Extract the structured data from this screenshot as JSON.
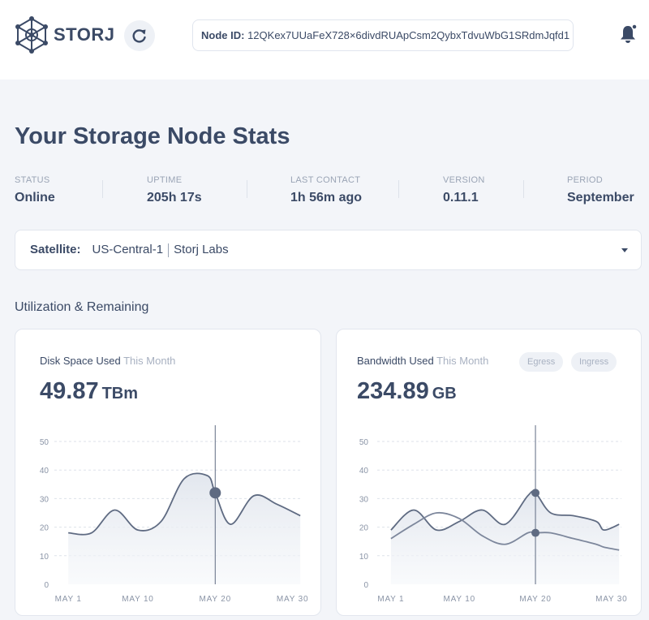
{
  "header": {
    "logo_text": "STORJ",
    "node_id_label": "Node ID:",
    "node_id_value": "12QKex7UUaFeX728×6divdRUApCsm2QybxTdvuWbG1SRdmJqfd1"
  },
  "page_title": "Your Storage Node Stats",
  "stats": [
    {
      "label": "STATUS",
      "value": "Online"
    },
    {
      "label": "UPTIME",
      "value": "205h 17s"
    },
    {
      "label": "LAST CONTACT",
      "value": "1h 56m ago"
    },
    {
      "label": "VERSION",
      "value": "0.11.1"
    },
    {
      "label": "PERIOD",
      "value": "September"
    }
  ],
  "satellite": {
    "label": "Satellite:",
    "name": "US-Central-1",
    "owner": "Storj Labs"
  },
  "section_title": "Utilization & Remaining",
  "disk_card": {
    "title": "Disk Space Used",
    "title_muted": "This Month",
    "value": "49.87",
    "unit": "TBm"
  },
  "bandwidth_card": {
    "title": "Bandwidth Used",
    "title_muted": "This Month",
    "value": "234.89",
    "unit": "GB",
    "pills": [
      "Egress",
      "Ingress"
    ]
  },
  "colors": {
    "text": "#3b4a66",
    "muted": "#9aa4b5",
    "line": "#7d879c",
    "line_dark": "#5f6b82"
  },
  "chart_data": [
    {
      "type": "area",
      "x": [
        1,
        4,
        7,
        10,
        13,
        16,
        19,
        20,
        22,
        25,
        28,
        31
      ],
      "series": [
        {
          "values": [
            18,
            18,
            26,
            19,
            22,
            37,
            38,
            32,
            21,
            31,
            28,
            24
          ]
        }
      ],
      "marker": {
        "x": 20,
        "y": 32
      },
      "ylim": [
        0,
        50
      ],
      "y_ticks": [
        "0",
        "10",
        "20",
        "30",
        "40",
        "50"
      ],
      "x_ticks": [
        {
          "x": 1,
          "label": "MAY 1"
        },
        {
          "x": 10,
          "label": "MAY 10"
        },
        {
          "x": 20,
          "label": "MAY 20"
        },
        {
          "x": 30,
          "label": "MAY 30"
        }
      ],
      "xlim": [
        -0.8,
        31.3
      ],
      "grid": true
    },
    {
      "type": "area",
      "x": [
        1,
        4,
        7,
        10,
        13,
        16,
        19,
        20,
        22,
        25,
        28,
        29,
        31
      ],
      "series": [
        {
          "values": [
            19,
            26,
            19,
            22,
            26,
            21,
            31,
            32,
            25,
            24,
            22,
            19,
            21
          ]
        },
        {
          "values": [
            16,
            21,
            25,
            23,
            17,
            14,
            18,
            18,
            18,
            16,
            14,
            13,
            12
          ]
        }
      ],
      "marker_points": [
        {
          "x": 20,
          "y": 32
        },
        {
          "x": 20,
          "y": 18
        }
      ],
      "ylim": [
        0,
        50
      ],
      "y_ticks": [
        "0",
        "10",
        "20",
        "30",
        "40",
        "50"
      ],
      "x_ticks": [
        {
          "x": 1,
          "label": "MAY 1"
        },
        {
          "x": 10,
          "label": "MAY 10"
        },
        {
          "x": 20,
          "label": "MAY 20"
        },
        {
          "x": 30,
          "label": "MAY 30"
        }
      ],
      "xlim": [
        -0.8,
        31.3
      ],
      "grid": true
    }
  ]
}
